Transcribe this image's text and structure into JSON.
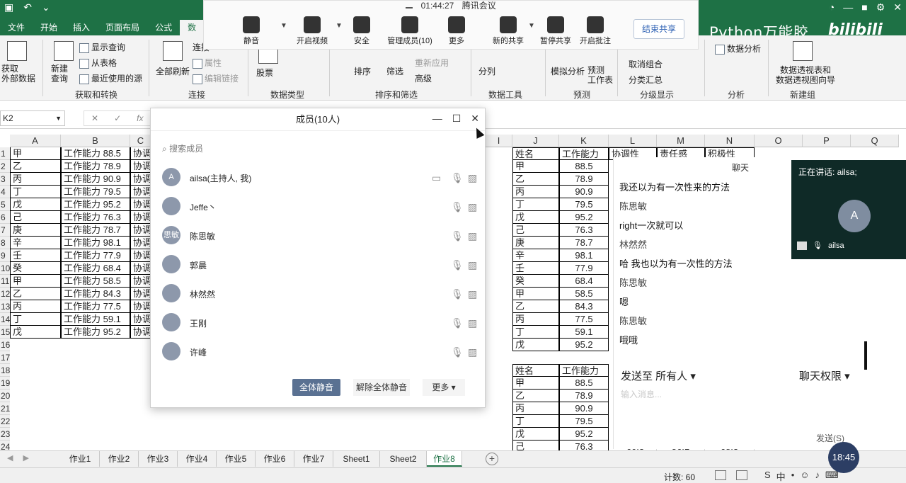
{
  "excel": {
    "menu": [
      "文件",
      "开始",
      "插入",
      "页面布局",
      "公式",
      "数"
    ],
    "active_menu_index": 5,
    "brand": "Python万能胶",
    "brand_logo": "bilibili",
    "ribbon": {
      "get_external": "获取\n外部数据",
      "new_query": "新建\n查询",
      "show_query": "显示查询",
      "from_table": "从表格",
      "recent_sources": "最近使用的源",
      "group_get_transform": "获取和转换",
      "refresh_all": "全部刷新",
      "connections": "连接",
      "properties": "属性",
      "edit_links": "编辑链接",
      "group_connections": "连接",
      "stocks": "股票",
      "group_data_types": "数据类型",
      "sort": "排序",
      "filter": "筛选",
      "reapply": "重新应用",
      "advanced": "高级",
      "group_sort_filter": "排序和筛选",
      "text_to_columns": "分列",
      "group_data_tools": "数据工具",
      "what_if": "模拟分析",
      "forecast_sheet": "预测\n工作表",
      "group_forecast": "预测",
      "ungroup": "取消组合",
      "subtotal": "分类汇总",
      "group_outline": "分级显示",
      "data_analysis": "数据分析",
      "group_analysis": "分析",
      "pivot_wizard": "数据透视表和\n数据透视图向导",
      "group_new": "新建组"
    },
    "name_box": "K2",
    "columns_left": [
      "A",
      "B",
      "C"
    ],
    "columns_right": [
      "I",
      "J",
      "K",
      "L",
      "M",
      "N",
      "O",
      "P",
      "Q"
    ],
    "rows": [
      "1",
      "2",
      "3",
      "4",
      "5",
      "6",
      "7",
      "8",
      "9",
      "10",
      "11",
      "12",
      "13",
      "14",
      "15",
      "16",
      "17",
      "18",
      "19",
      "20",
      "21",
      "22",
      "23",
      "24"
    ],
    "left_table": [
      {
        "a": "甲",
        "b": "工作能力 88.5",
        "c": "协调"
      },
      {
        "a": "乙",
        "b": "工作能力 78.9",
        "c": "协调"
      },
      {
        "a": "丙",
        "b": "工作能力 90.9",
        "c": "协调"
      },
      {
        "a": "丁",
        "b": "工作能力 79.5",
        "c": "协调"
      },
      {
        "a": "戊",
        "b": "工作能力 95.2",
        "c": "协调"
      },
      {
        "a": "己",
        "b": "工作能力 76.3",
        "c": "协调"
      },
      {
        "a": "庚",
        "b": "工作能力 78.7",
        "c": "协调"
      },
      {
        "a": "辛",
        "b": "工作能力 98.1",
        "c": "协调"
      },
      {
        "a": "壬",
        "b": "工作能力 77.9",
        "c": "协调"
      },
      {
        "a": "癸",
        "b": "工作能力 68.4",
        "c": "协调"
      },
      {
        "a": "甲",
        "b": "工作能力 58.5",
        "c": "协调"
      },
      {
        "a": "乙",
        "b": "工作能力 84.3",
        "c": "协调"
      },
      {
        "a": "丙",
        "b": "工作能力 77.5",
        "c": "协调"
      },
      {
        "a": "丁",
        "b": "工作能力 59.1",
        "c": "协调"
      },
      {
        "a": "戊",
        "b": "工作能力 95.2",
        "c": "协调"
      }
    ],
    "right_header": [
      "姓名",
      "工作能力",
      "协调性",
      "责任感",
      "积极性"
    ],
    "right_table1": [
      {
        "name": "甲",
        "score": "88.5"
      },
      {
        "name": "乙",
        "score": "78.9"
      },
      {
        "name": "丙",
        "score": "90.9"
      },
      {
        "name": "丁",
        "score": "79.5"
      },
      {
        "name": "戊",
        "score": "95.2"
      },
      {
        "name": "己",
        "score": "76.3"
      },
      {
        "name": "庚",
        "score": "78.7"
      },
      {
        "name": "辛",
        "score": "98.1"
      },
      {
        "name": "壬",
        "score": "77.9"
      },
      {
        "name": "癸",
        "score": "68.4"
      },
      {
        "name": "甲",
        "score": "58.5"
      },
      {
        "name": "乙",
        "score": "84.3"
      },
      {
        "name": "丙",
        "score": "77.5"
      },
      {
        "name": "丁",
        "score": "59.1"
      },
      {
        "name": "戊",
        "score": "95.2"
      }
    ],
    "right_table2_header": [
      "姓名",
      "工作能力"
    ],
    "right_table2": [
      {
        "name": "甲",
        "score": "88.5"
      },
      {
        "name": "乙",
        "score": "78.9"
      },
      {
        "name": "丙",
        "score": "90.9"
      },
      {
        "name": "丁",
        "score": "79.5"
      },
      {
        "name": "戊",
        "score": "95.2"
      },
      {
        "name": "己",
        "score": "76.3"
      }
    ],
    "row24_extra": [
      "60.3",
      "56.1",
      "68.3"
    ],
    "sheets": [
      "作业1",
      "作业2",
      "作业3",
      "作业4",
      "作业5",
      "作业6",
      "作业7",
      "Sheet1",
      "Sheet2",
      "作业8"
    ],
    "active_sheet_index": 9,
    "status_count": "计数: 60",
    "ime": "中"
  },
  "meeting": {
    "time": "01:44:27",
    "app": "腾讯会议",
    "buttons": [
      {
        "label": "静音",
        "icon": "microphone-icon"
      },
      {
        "label": "开启视频",
        "icon": "video-off-icon"
      },
      {
        "label": "安全",
        "icon": "shield-icon"
      },
      {
        "label": "管理成员(10)",
        "icon": "members-icon"
      },
      {
        "label": "更多",
        "icon": "more-icon"
      },
      {
        "label": "新的共享",
        "icon": "share-icon"
      },
      {
        "label": "暂停共享",
        "icon": "pause-share-icon"
      },
      {
        "label": "开启批注",
        "icon": "annotate-icon"
      }
    ],
    "end_share": "结束共享"
  },
  "members_panel": {
    "title": "成员(10人)",
    "search_placeholder": "搜索成员",
    "members": [
      {
        "name": "ailsa(主持人, 我)",
        "avatar": "A"
      },
      {
        "name": "Jeffe丶",
        "avatar": ""
      },
      {
        "name": "陈思敏",
        "avatar": "思敏"
      },
      {
        "name": "郭晨",
        "avatar": ""
      },
      {
        "name": "林然然",
        "avatar": ""
      },
      {
        "name": "王刚",
        "avatar": ""
      },
      {
        "name": "许峰",
        "avatar": ""
      }
    ],
    "mute_all": "全体静音",
    "unmute_all": "解除全体静音",
    "more": "更多"
  },
  "chat": {
    "title": "聊天",
    "messages": [
      {
        "text": "我还以为有一次性来的方法",
        "type": "msg"
      },
      {
        "text": "陈思敏",
        "type": "sender"
      },
      {
        "text": "right一次就可以",
        "type": "msg"
      },
      {
        "text": "林然然",
        "type": "sender"
      },
      {
        "text": "哈 我也以为有一次性的方法",
        "type": "msg"
      },
      {
        "text": "陈思敏",
        "type": "sender"
      },
      {
        "text": "嗯",
        "type": "msg"
      },
      {
        "text": "陈思敏",
        "type": "sender"
      },
      {
        "text": "哦哦",
        "type": "msg"
      }
    ],
    "send_to": "发送至 所有人",
    "permission": "聊天权限",
    "placeholder": "输入消息...",
    "send": "发送(S)"
  },
  "speaker": {
    "label": "正在讲话: ailsa;",
    "avatar": "A",
    "name": "ailsa"
  },
  "timer": "18:45",
  "colors": {
    "excel_green": "#1e7145",
    "speaker_bg": "#0f2a27",
    "mute_btn": "#5a7192"
  }
}
